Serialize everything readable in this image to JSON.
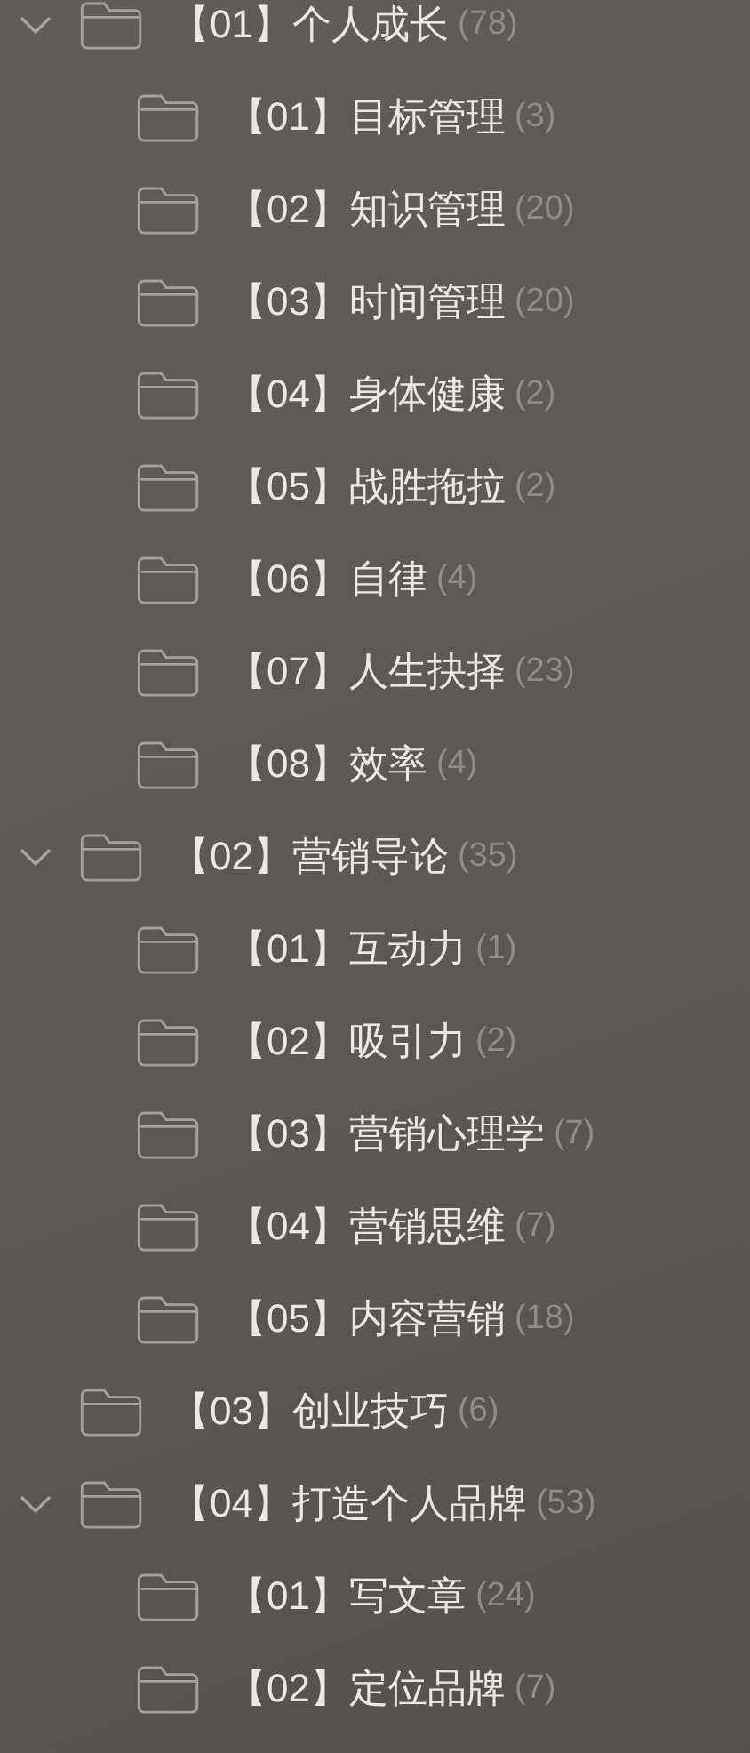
{
  "folders": [
    {
      "name": "【01】个人成长",
      "count": "(78)",
      "expanded": true,
      "children": [
        {
          "name": "【01】目标管理",
          "count": "(3)"
        },
        {
          "name": "【02】知识管理",
          "count": "(20)"
        },
        {
          "name": "【03】时间管理",
          "count": "(20)"
        },
        {
          "name": "【04】身体健康",
          "count": "(2)"
        },
        {
          "name": "【05】战胜拖拉",
          "count": "(2)"
        },
        {
          "name": "【06】自律",
          "count": "(4)"
        },
        {
          "name": "【07】人生抉择",
          "count": "(23)"
        },
        {
          "name": "【08】效率",
          "count": "(4)"
        }
      ]
    },
    {
      "name": "【02】营销导论",
      "count": "(35)",
      "expanded": true,
      "children": [
        {
          "name": "【01】互动力",
          "count": "(1)"
        },
        {
          "name": "【02】吸引力",
          "count": "(2)"
        },
        {
          "name": "【03】营销心理学",
          "count": "(7)"
        },
        {
          "name": "【04】营销思维",
          "count": "(7)"
        },
        {
          "name": "【05】内容营销",
          "count": "(18)"
        }
      ]
    },
    {
      "name": "【03】创业技巧",
      "count": "(6)"
    },
    {
      "name": "【04】打造个人品牌",
      "count": "(53)",
      "expanded": true,
      "children": [
        {
          "name": "【01】写文章",
          "count": "(24)"
        },
        {
          "name": "【02】定位品牌",
          "count": "(7)"
        }
      ]
    }
  ]
}
